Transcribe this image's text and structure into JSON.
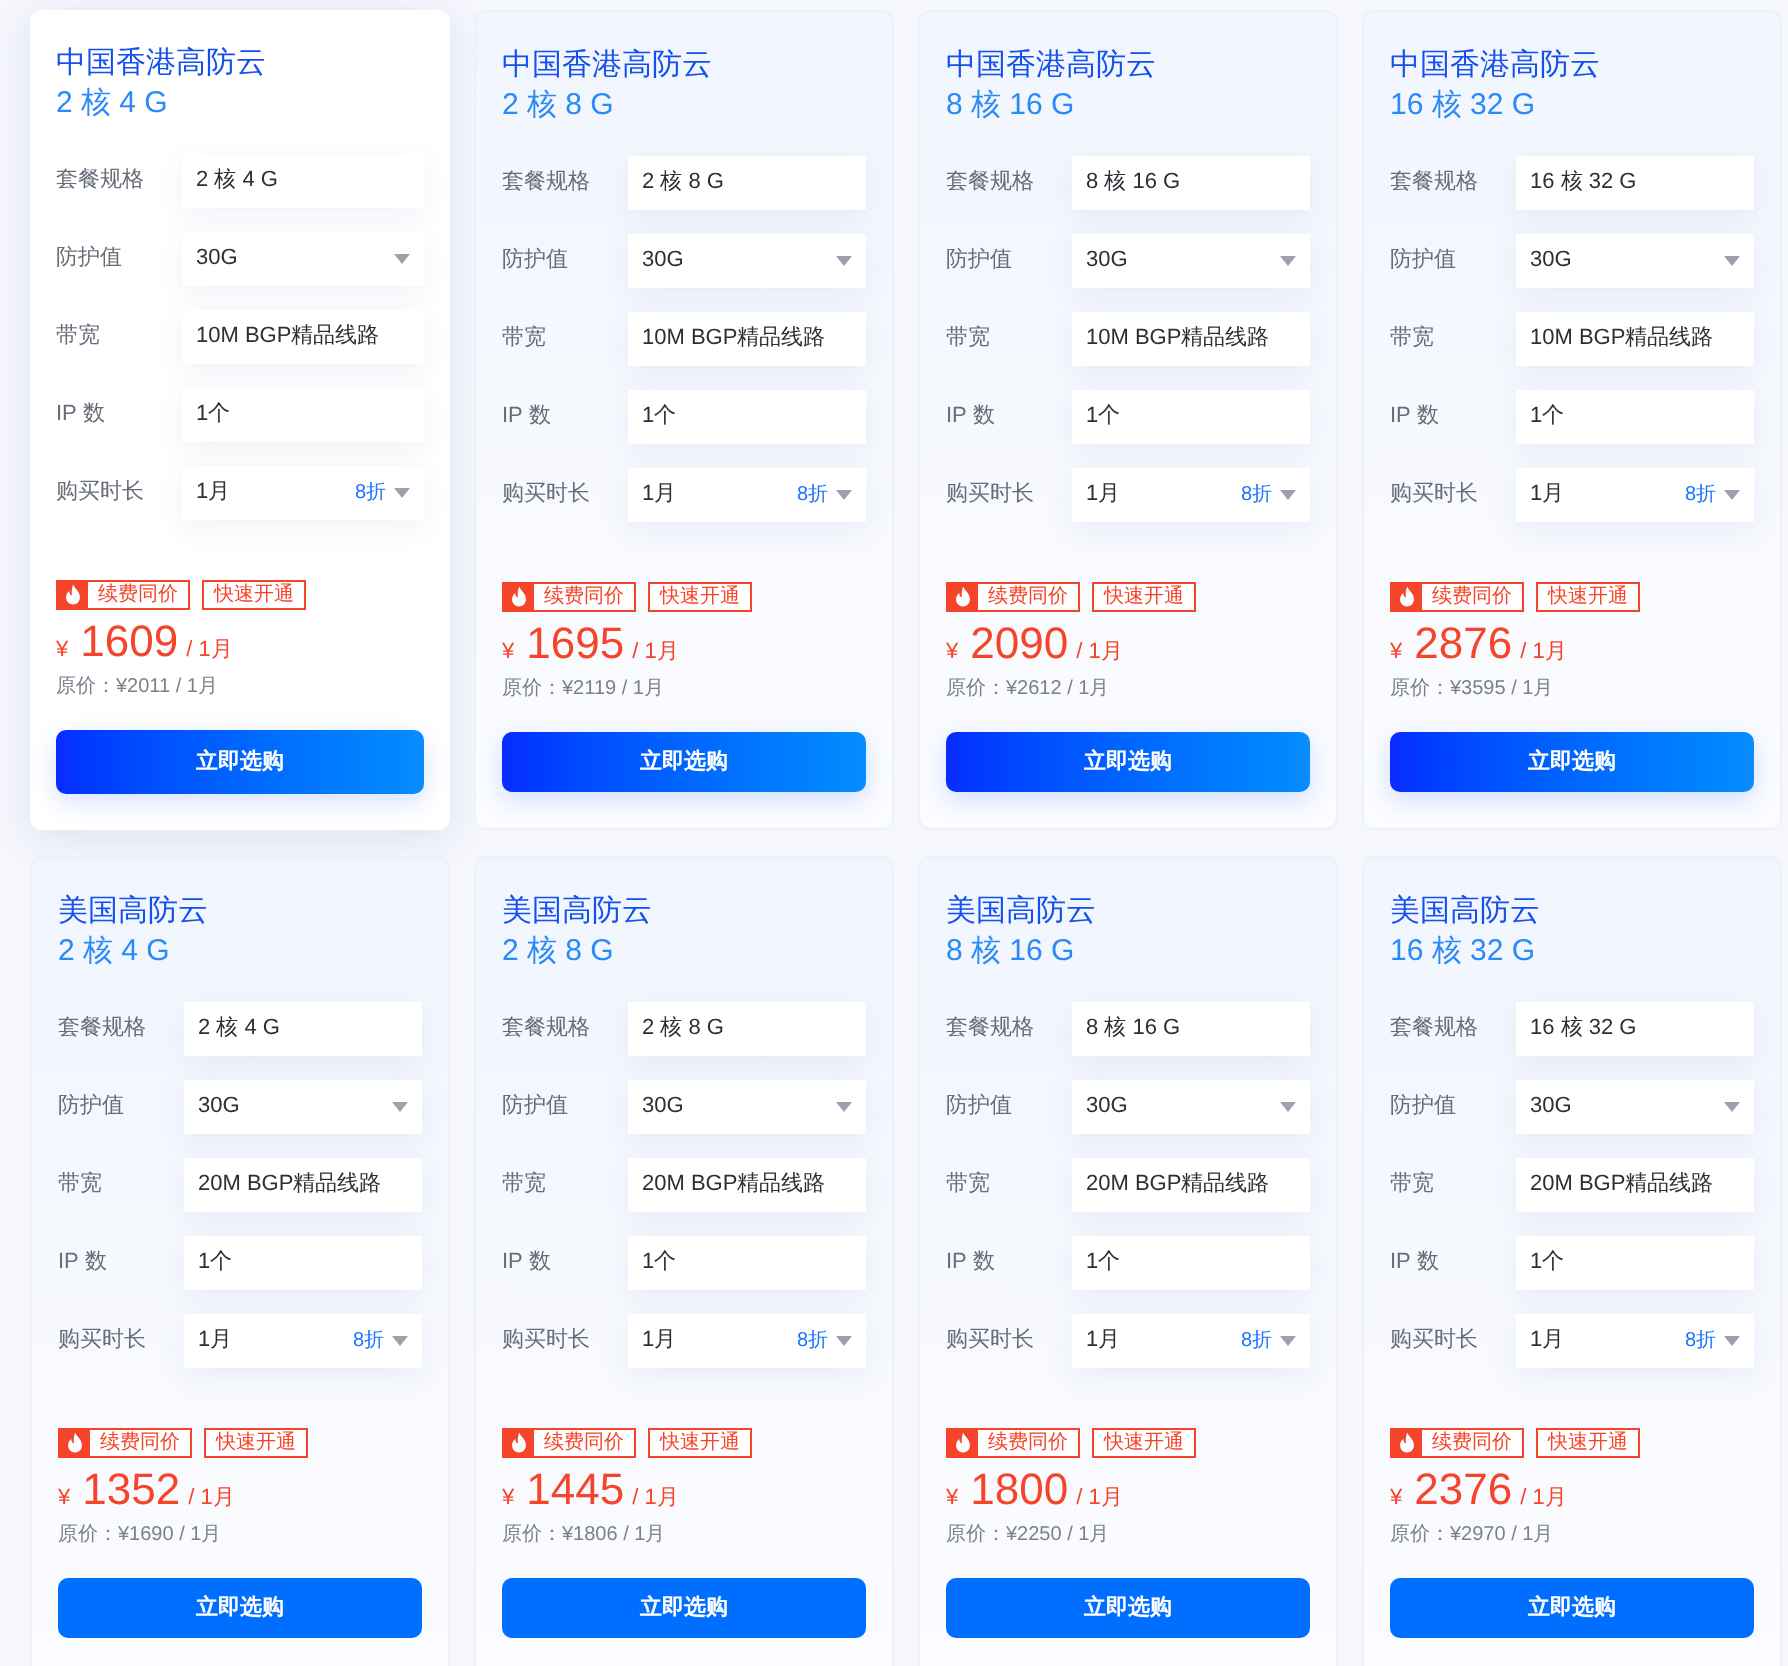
{
  "sections": [
    {
      "cards": [
        {
          "title": "中国香港高防云",
          "spec": "2 核 4 G",
          "highlighted": true,
          "rows": [
            {
              "label": "套餐规格",
              "value": "2 核 4 G",
              "kind": "text"
            },
            {
              "label": "防护值",
              "value": "30G",
              "kind": "select"
            },
            {
              "label": "带宽",
              "value": "10M BGP精品线路",
              "kind": "text"
            },
            {
              "label": "IP 数",
              "value": "1个",
              "kind": "text"
            },
            {
              "label": "购买时长",
              "value": "1月",
              "kind": "select",
              "discount": "8折"
            }
          ],
          "tags": [
            {
              "text": "续费同价",
              "kind": "hot"
            },
            {
              "text": "快速开通",
              "kind": "plain"
            }
          ],
          "price": {
            "currency": "¥",
            "amount": "1609",
            "period": "/ 1月",
            "original": "原价：¥2011 / 1月"
          },
          "button": {
            "label": "立即选购",
            "kind": "gradient"
          }
        },
        {
          "title": "中国香港高防云",
          "spec": "2 核 8 G",
          "highlighted": false,
          "rows": [
            {
              "label": "套餐规格",
              "value": "2 核 8 G",
              "kind": "text"
            },
            {
              "label": "防护值",
              "value": "30G",
              "kind": "select"
            },
            {
              "label": "带宽",
              "value": "10M BGP精品线路",
              "kind": "text"
            },
            {
              "label": "IP 数",
              "value": "1个",
              "kind": "text"
            },
            {
              "label": "购买时长",
              "value": "1月",
              "kind": "select",
              "discount": "8折"
            }
          ],
          "tags": [
            {
              "text": "续费同价",
              "kind": "hot"
            },
            {
              "text": "快速开通",
              "kind": "plain"
            }
          ],
          "price": {
            "currency": "¥",
            "amount": "1695",
            "period": "/ 1月",
            "original": "原价：¥2119 / 1月"
          },
          "button": {
            "label": "立即选购",
            "kind": "gradient"
          }
        },
        {
          "title": "中国香港高防云",
          "spec": "8 核 16 G",
          "highlighted": false,
          "rows": [
            {
              "label": "套餐规格",
              "value": "8 核 16 G",
              "kind": "text"
            },
            {
              "label": "防护值",
              "value": "30G",
              "kind": "select"
            },
            {
              "label": "带宽",
              "value": "10M BGP精品线路",
              "kind": "text"
            },
            {
              "label": "IP 数",
              "value": "1个",
              "kind": "text"
            },
            {
              "label": "购买时长",
              "value": "1月",
              "kind": "select",
              "discount": "8折"
            }
          ],
          "tags": [
            {
              "text": "续费同价",
              "kind": "hot"
            },
            {
              "text": "快速开通",
              "kind": "plain"
            }
          ],
          "price": {
            "currency": "¥",
            "amount": "2090",
            "period": "/ 1月",
            "original": "原价：¥2612 / 1月"
          },
          "button": {
            "label": "立即选购",
            "kind": "gradient"
          }
        },
        {
          "title": "中国香港高防云",
          "spec": "16 核 32 G",
          "highlighted": false,
          "rows": [
            {
              "label": "套餐规格",
              "value": "16 核 32 G",
              "kind": "text"
            },
            {
              "label": "防护值",
              "value": "30G",
              "kind": "select"
            },
            {
              "label": "带宽",
              "value": "10M BGP精品线路",
              "kind": "text"
            },
            {
              "label": "IP 数",
              "value": "1个",
              "kind": "text"
            },
            {
              "label": "购买时长",
              "value": "1月",
              "kind": "select",
              "discount": "8折"
            }
          ],
          "tags": [
            {
              "text": "续费同价",
              "kind": "hot"
            },
            {
              "text": "快速开通",
              "kind": "plain"
            }
          ],
          "price": {
            "currency": "¥",
            "amount": "2876",
            "period": "/ 1月",
            "original": "原价：¥3595 / 1月"
          },
          "button": {
            "label": "立即选购",
            "kind": "gradient"
          }
        }
      ]
    },
    {
      "cards": [
        {
          "title": "美国高防云",
          "spec": "2 核 4 G",
          "highlighted": false,
          "rows": [
            {
              "label": "套餐规格",
              "value": "2 核 4 G",
              "kind": "text"
            },
            {
              "label": "防护值",
              "value": "30G",
              "kind": "select"
            },
            {
              "label": "带宽",
              "value": "20M BGP精品线路",
              "kind": "text"
            },
            {
              "label": "IP 数",
              "value": "1个",
              "kind": "text"
            },
            {
              "label": "购买时长",
              "value": "1月",
              "kind": "select",
              "discount": "8折"
            }
          ],
          "tags": [
            {
              "text": "续费同价",
              "kind": "hot"
            },
            {
              "text": "快速开通",
              "kind": "plain"
            }
          ],
          "price": {
            "currency": "¥",
            "amount": "1352",
            "period": "/ 1月",
            "original": "原价：¥1690 / 1月"
          },
          "button": {
            "label": "立即选购",
            "kind": "solid"
          }
        },
        {
          "title": "美国高防云",
          "spec": "2 核 8 G",
          "highlighted": false,
          "rows": [
            {
              "label": "套餐规格",
              "value": "2 核 8 G",
              "kind": "text"
            },
            {
              "label": "防护值",
              "value": "30G",
              "kind": "select"
            },
            {
              "label": "带宽",
              "value": "20M BGP精品线路",
              "kind": "text"
            },
            {
              "label": "IP 数",
              "value": "1个",
              "kind": "text"
            },
            {
              "label": "购买时长",
              "value": "1月",
              "kind": "select",
              "discount": "8折"
            }
          ],
          "tags": [
            {
              "text": "续费同价",
              "kind": "hot"
            },
            {
              "text": "快速开通",
              "kind": "plain"
            }
          ],
          "price": {
            "currency": "¥",
            "amount": "1445",
            "period": "/ 1月",
            "original": "原价：¥1806 / 1月"
          },
          "button": {
            "label": "立即选购",
            "kind": "solid"
          }
        },
        {
          "title": "美国高防云",
          "spec": "8 核 16 G",
          "highlighted": false,
          "rows": [
            {
              "label": "套餐规格",
              "value": "8 核 16 G",
              "kind": "text"
            },
            {
              "label": "防护值",
              "value": "30G",
              "kind": "select"
            },
            {
              "label": "带宽",
              "value": "20M BGP精品线路",
              "kind": "text"
            },
            {
              "label": "IP 数",
              "value": "1个",
              "kind": "text"
            },
            {
              "label": "购买时长",
              "value": "1月",
              "kind": "select",
              "discount": "8折"
            }
          ],
          "tags": [
            {
              "text": "续费同价",
              "kind": "hot"
            },
            {
              "text": "快速开通",
              "kind": "plain"
            }
          ],
          "price": {
            "currency": "¥",
            "amount": "1800",
            "period": "/ 1月",
            "original": "原价：¥2250 / 1月"
          },
          "button": {
            "label": "立即选购",
            "kind": "solid"
          }
        },
        {
          "title": "美国高防云",
          "spec": "16 核 32 G",
          "highlighted": false,
          "rows": [
            {
              "label": "套餐规格",
              "value": "16 核 32 G",
              "kind": "text"
            },
            {
              "label": "防护值",
              "value": "30G",
              "kind": "select"
            },
            {
              "label": "带宽",
              "value": "20M BGP精品线路",
              "kind": "text"
            },
            {
              "label": "IP 数",
              "value": "1个",
              "kind": "text"
            },
            {
              "label": "购买时长",
              "value": "1月",
              "kind": "select",
              "discount": "8折"
            }
          ],
          "tags": [
            {
              "text": "续费同价",
              "kind": "hot"
            },
            {
              "text": "快速开通",
              "kind": "plain"
            }
          ],
          "price": {
            "currency": "¥",
            "amount": "2376",
            "period": "/ 1月",
            "original": "原价：¥2970 / 1月"
          },
          "button": {
            "label": "立即选购",
            "kind": "solid"
          }
        }
      ]
    }
  ]
}
